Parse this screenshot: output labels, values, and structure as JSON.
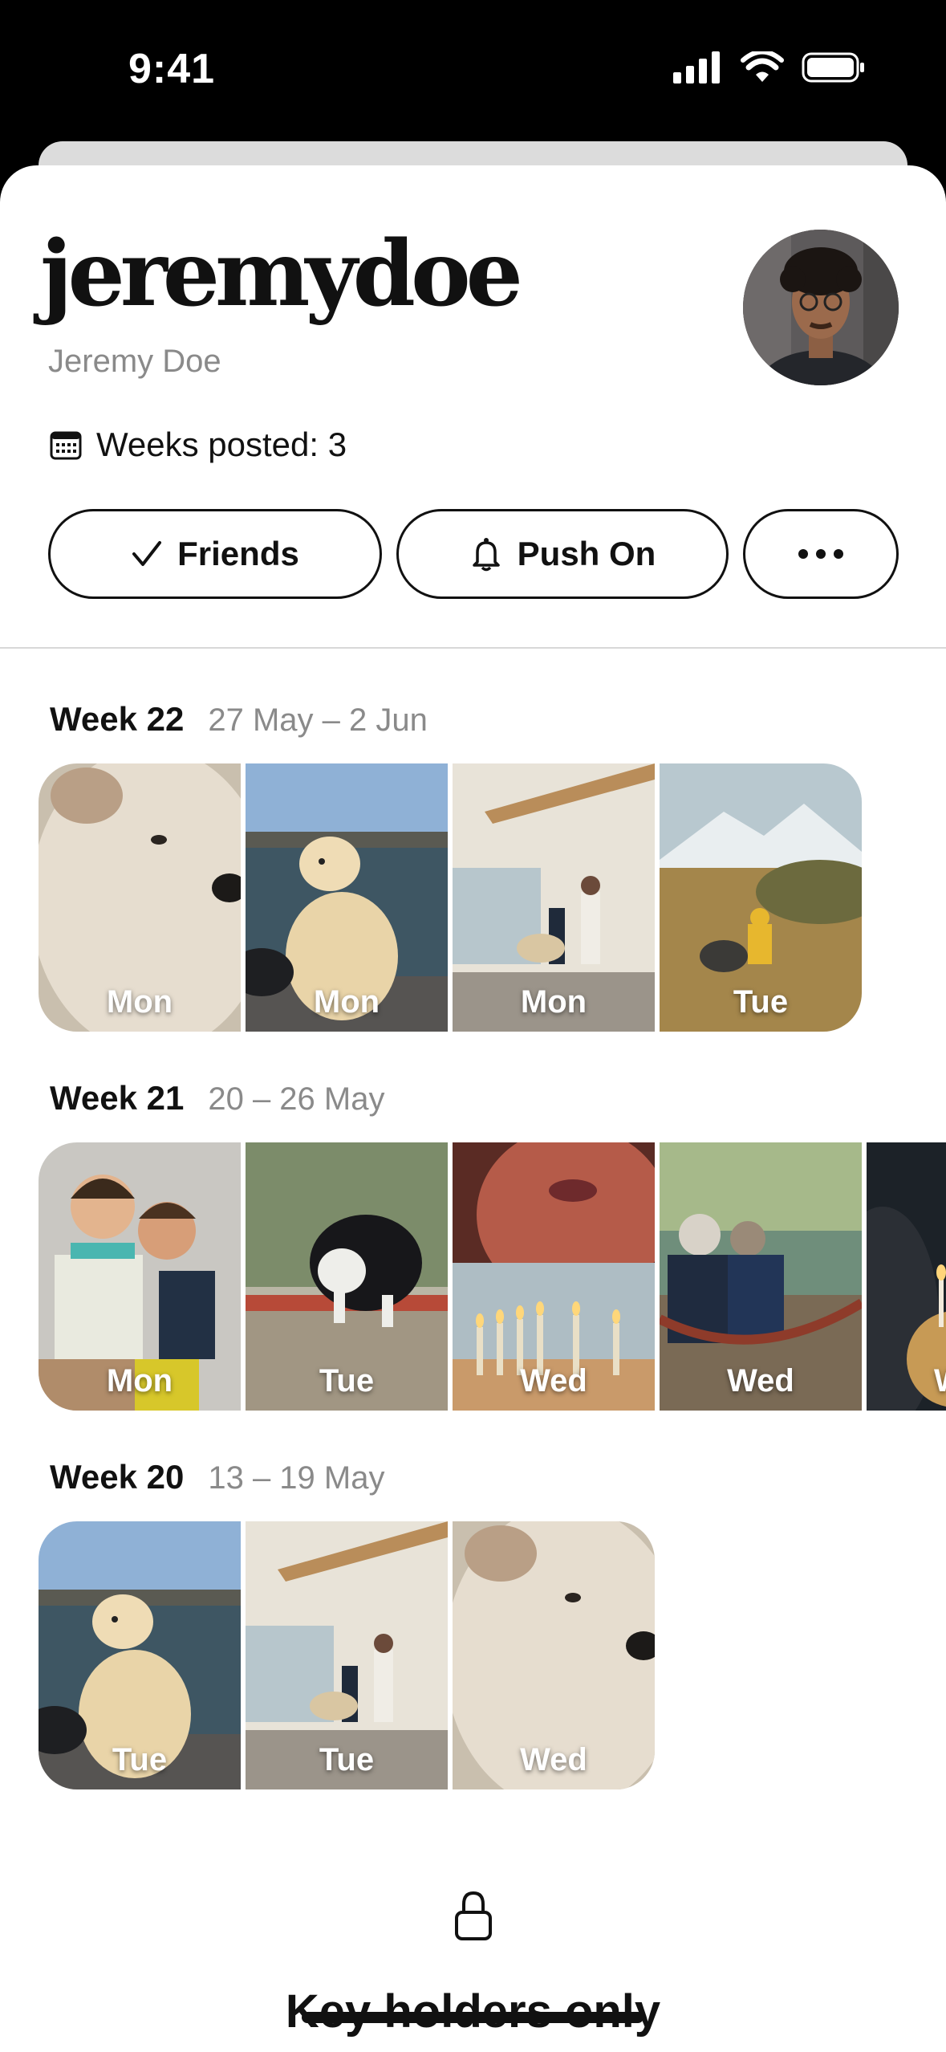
{
  "status_bar": {
    "time": "9:41"
  },
  "profile": {
    "username": "jeremydoe",
    "full_name": "Jeremy Doe",
    "weeks_posted": "Weeks posted: 3"
  },
  "actions": {
    "friends_label": "Friends",
    "push_label": "Push On"
  },
  "weeks": [
    {
      "title": "Week 22",
      "range": "27 May – 2 Jun",
      "photos": [
        {
          "day": "Mon",
          "subject": "white fluffy dog close-up"
        },
        {
          "day": "Mon",
          "subject": "golden retriever by the sea"
        },
        {
          "day": "Mon",
          "subject": "people with dog in room"
        },
        {
          "day": "Tue",
          "subject": "child with dog in mountains"
        }
      ]
    },
    {
      "title": "Week 21",
      "range": "20 – 26 May",
      "photos": [
        {
          "day": "Mon",
          "subject": "two kids hugging"
        },
        {
          "day": "Tue",
          "subject": "border collie in park"
        },
        {
          "day": "Wed",
          "subject": "blowing birthday candles"
        },
        {
          "day": "Wed",
          "subject": "couple on hammock by lake"
        },
        {
          "day": "W",
          "subject": "birthday cake candles"
        }
      ]
    },
    {
      "title": "Week 20",
      "range": "13 – 19 May",
      "photos": [
        {
          "day": "Tue",
          "subject": "golden retriever by the sea"
        },
        {
          "day": "Tue",
          "subject": "people with dog in room"
        },
        {
          "day": "Wed",
          "subject": "white fluffy dog close-up"
        }
      ]
    }
  ],
  "footer": {
    "text": "Key holders only"
  },
  "icons": {
    "weeks": "calendar-icon",
    "friends": "checkmark-icon",
    "push": "bell-icon",
    "more": "more-icon",
    "footer": "lock-icon"
  }
}
